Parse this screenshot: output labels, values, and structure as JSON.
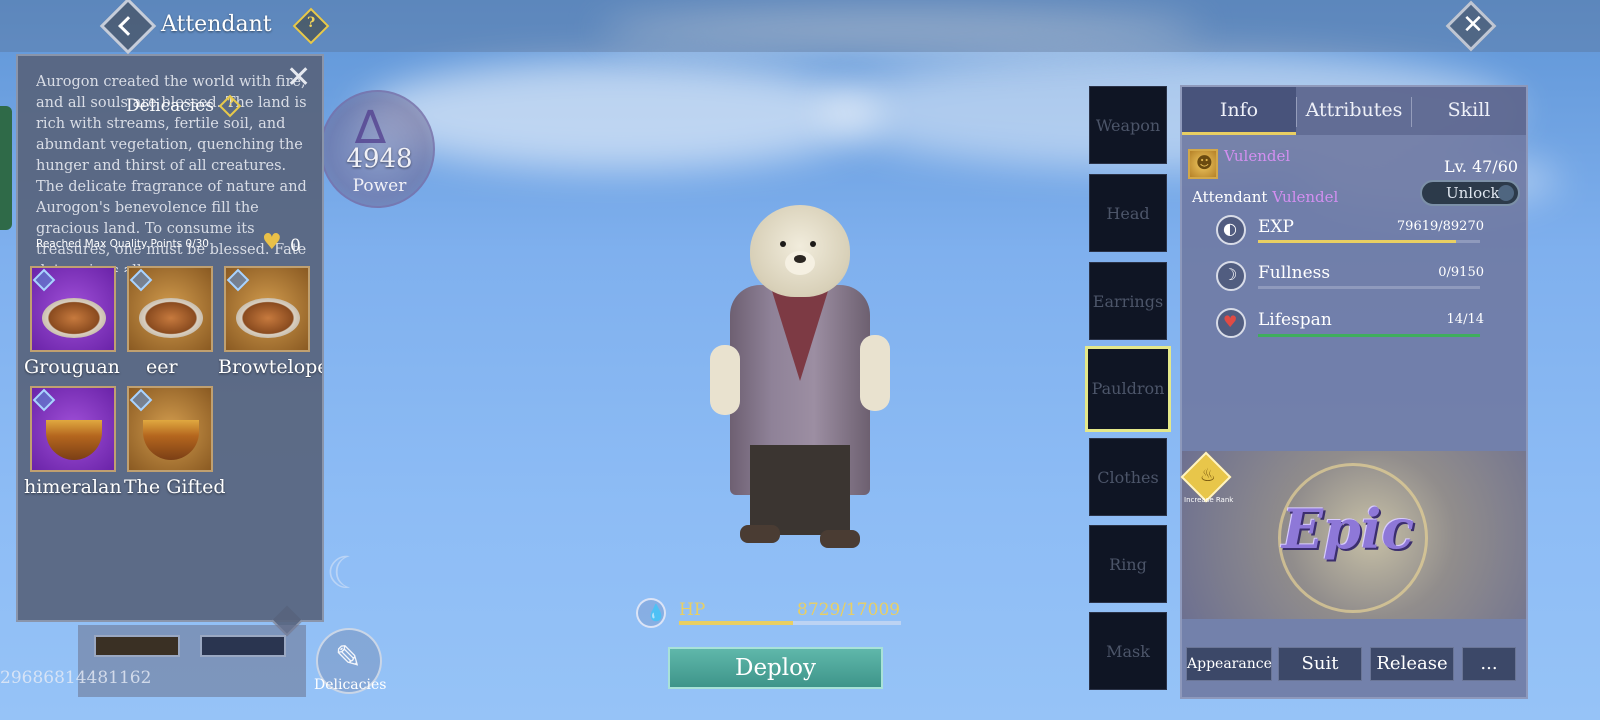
{
  "header": {
    "title": "Attendant"
  },
  "power": {
    "value": "4948",
    "label": "Power"
  },
  "delicacies_panel": {
    "title": "Delicacies",
    "description": "Aurogon created the world with fire, and all souls are blessed. The land is rich with streams, fertile soil, and abundant vegetation, quenching the hunger and thirst of all creatures. The delicate fragrance of nature and Aurogon's benevolence fill the gracious land. To consume its treasures, one must be blessed. Fate determines all.",
    "quality_text": "Reached Max Quality Points 0/30",
    "heart_count": "0",
    "items": [
      {
        "name": "Grouguan",
        "rarity": "purple"
      },
      {
        "name": "eer",
        "rarity": "orange"
      },
      {
        "name": "Browtelope",
        "rarity": "orange"
      },
      {
        "name": "himeralan",
        "rarity": "purple"
      },
      {
        "name": "The Gifted",
        "rarity": "orange"
      }
    ]
  },
  "uid": "29686814481162",
  "delicacies_button": {
    "label": "Delicacies"
  },
  "hp": {
    "label": "HP",
    "value": "8729/17009",
    "current": 8729,
    "max": 17009
  },
  "deploy_button": {
    "label": "Deploy"
  },
  "equipment_slots": [
    {
      "label": "Weapon"
    },
    {
      "label": "Head"
    },
    {
      "label": "Earrings"
    },
    {
      "label": "Pauldron"
    },
    {
      "label": "Clothes"
    },
    {
      "label": "Ring"
    },
    {
      "label": "Mask"
    }
  ],
  "info_panel": {
    "tabs": [
      {
        "label": "Info"
      },
      {
        "label": "Attributes"
      },
      {
        "label": "Skill"
      }
    ],
    "pet_name": "Vulendel",
    "level": "Lv. 47/60",
    "attendant_label": "Attendant",
    "attendant_name": "Vulendel",
    "unlock_label": "Unlock",
    "stats": [
      {
        "label": "EXP",
        "value": "79619/89270",
        "current": 79619,
        "max": 89270,
        "color": "#e9cf62"
      },
      {
        "label": "Fullness",
        "value": "0/9150",
        "current": 0,
        "max": 9150,
        "color": "#e9cf62"
      },
      {
        "label": "Lifespan",
        "value": "14/14",
        "current": 14,
        "max": 14,
        "color": "#3fae5c"
      }
    ],
    "rank": {
      "increase_label": "Increase Rank",
      "value": "Epic"
    },
    "buttons": [
      {
        "label": "Appearance"
      },
      {
        "label": "Suit"
      },
      {
        "label": "Release"
      },
      {
        "label": "..."
      }
    ]
  }
}
